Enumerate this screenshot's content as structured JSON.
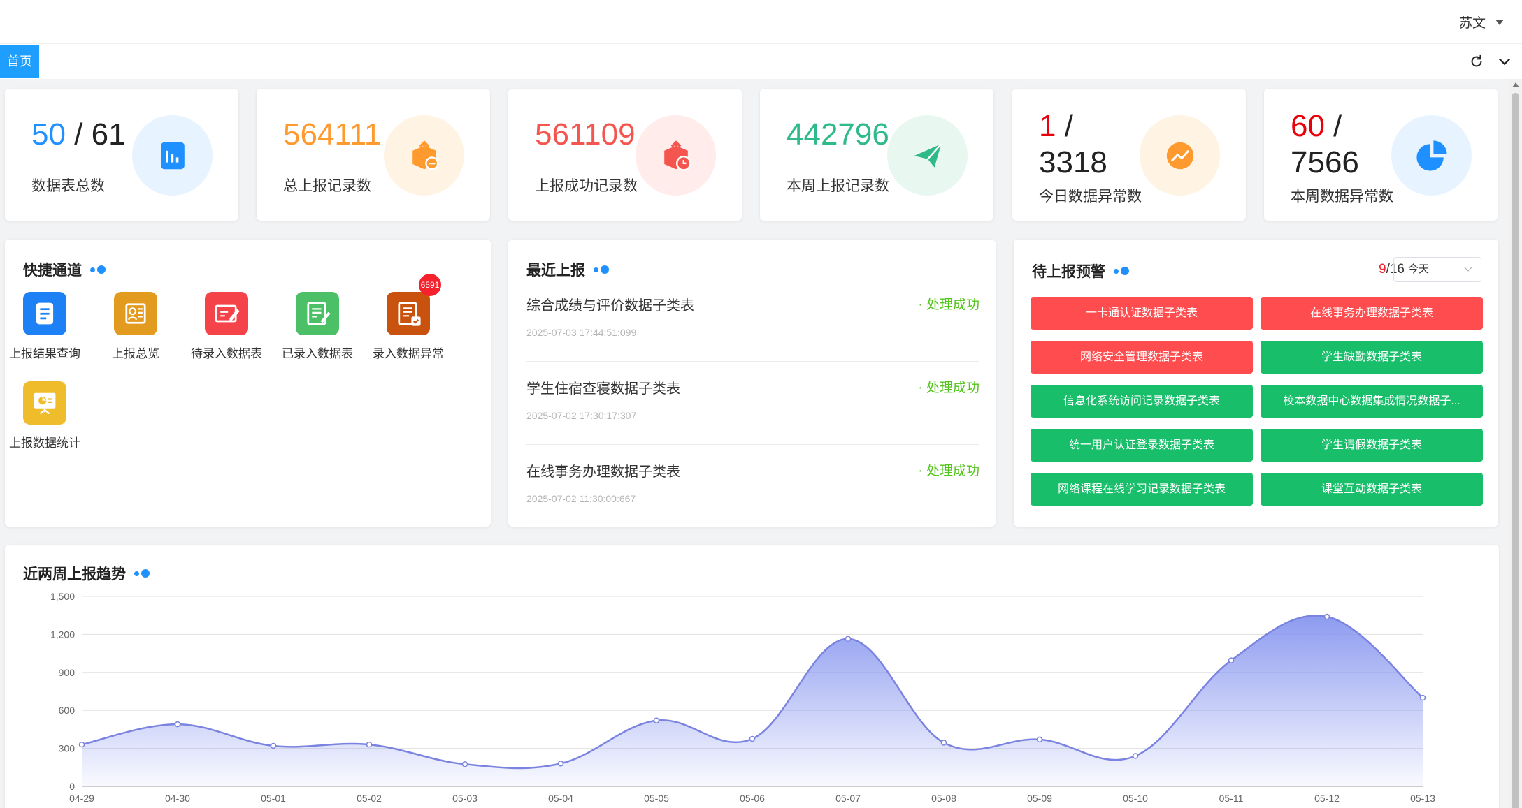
{
  "header": {
    "user_name": "苏文"
  },
  "tabs": {
    "home": "首页"
  },
  "stats": [
    {
      "value": "50",
      "total": "61",
      "label": "数据表总数",
      "value_color": "#1e90ff",
      "icon": "bar-chart-icon",
      "icon_bg": "#e7f4ff",
      "icon_color": "#1e90ff"
    },
    {
      "value": "564111",
      "total": null,
      "label": "总上报记录数",
      "value_color": "#ff9a2e",
      "icon": "upload-box-icon",
      "icon_bg": "#fff3e3",
      "icon_color": "#ff9a2e"
    },
    {
      "value": "561109",
      "total": null,
      "label": "上报成功记录数",
      "value_color": "#f4564f",
      "icon": "upload-clock-icon",
      "icon_bg": "#ffeceb",
      "icon_color": "#f4564f"
    },
    {
      "value": "442796",
      "total": null,
      "label": "本周上报记录数",
      "value_color": "#2fba8a",
      "icon": "paper-plane-icon",
      "icon_bg": "#e9f7f1",
      "icon_color": "#2fba8a"
    },
    {
      "value": "1",
      "total": "3318",
      "label": "今日数据异常数",
      "value_color": "#e8000b",
      "icon": "trend-icon",
      "icon_bg": "#fff3e3",
      "icon_color": "#ff9a2e"
    },
    {
      "value": "60",
      "total": "7566",
      "label": "本周数据异常数",
      "value_color": "#e8000b",
      "icon": "pie-chart-icon",
      "icon_bg": "#e7f4ff",
      "icon_color": "#1e90ff"
    }
  ],
  "quick_access": {
    "title": "快捷通道",
    "items": [
      {
        "label": "上报结果查询",
        "icon": "document-icon",
        "color": "#1e80f5"
      },
      {
        "label": "上报总览",
        "icon": "report-icon",
        "color": "#e39b1f"
      },
      {
        "label": "待录入数据表",
        "icon": "edit-form-icon",
        "color": "#f5434a"
      },
      {
        "label": "已录入数据表",
        "icon": "note-check-icon",
        "color": "#4cc067"
      },
      {
        "label": "录入数据异常",
        "icon": "list-error-icon",
        "color": "#c9520f",
        "badge": "6591"
      },
      {
        "label": "上报数据统计",
        "icon": "presentation-icon",
        "color": "#efbd2c"
      }
    ]
  },
  "recent_reports": {
    "title": "最近上报",
    "items": [
      {
        "name": "综合成绩与评价数据子类表",
        "status": "· 处理成功",
        "time": "2025-07-03 17:44:51:099"
      },
      {
        "name": "学生住宿查寝数据子类表",
        "status": "· 处理成功",
        "time": "2025-07-02 17:30:17:307"
      },
      {
        "name": "在线事务办理数据子类表",
        "status": "· 处理成功",
        "time": "2025-07-02 11:30:00:667"
      }
    ]
  },
  "pending_warnings": {
    "title": "待上报预警",
    "count_highlight": "9",
    "count_rest": "/16",
    "filter_value": "今天",
    "items": [
      {
        "label": "一卡通认证数据子类表",
        "level": "red"
      },
      {
        "label": "在线事务办理数据子类表",
        "level": "red"
      },
      {
        "label": "网络安全管理数据子类表",
        "level": "red"
      },
      {
        "label": "学生缺勤数据子类表",
        "level": "green"
      },
      {
        "label": "信息化系统访问记录数据子类表",
        "level": "green"
      },
      {
        "label": "校本数据中心数据集成情况数据子...",
        "level": "green"
      },
      {
        "label": "统一用户认证登录数据子类表",
        "level": "green"
      },
      {
        "label": "学生请假数据子类表",
        "level": "green"
      },
      {
        "label": "网络课程在线学习记录数据子类表",
        "level": "green"
      },
      {
        "label": "课堂互动数据子类表",
        "level": "green"
      }
    ]
  },
  "trend": {
    "title": "近两周上报趋势",
    "chart_data": {
      "type": "area",
      "categories": [
        "04-29",
        "04-30",
        "05-01",
        "05-02",
        "05-03",
        "05-04",
        "05-05",
        "05-06",
        "05-07",
        "05-08",
        "05-09",
        "05-10",
        "05-11",
        "05-12",
        "05-13"
      ],
      "series": [
        {
          "values": [
            330,
            490,
            320,
            330,
            175,
            180,
            520,
            375,
            1165,
            345,
            370,
            240,
            995,
            1340,
            700
          ]
        }
      ],
      "ylim": [
        0,
        1500
      ],
      "yticks": [
        "0",
        "300",
        "600",
        "900",
        "1,200",
        "1,500"
      ],
      "ytick_values": [
        0,
        300,
        600,
        900,
        1200,
        1500
      ],
      "grid": true,
      "line_color": "#7b83e0",
      "fill_color": "#8e9cf0"
    }
  }
}
